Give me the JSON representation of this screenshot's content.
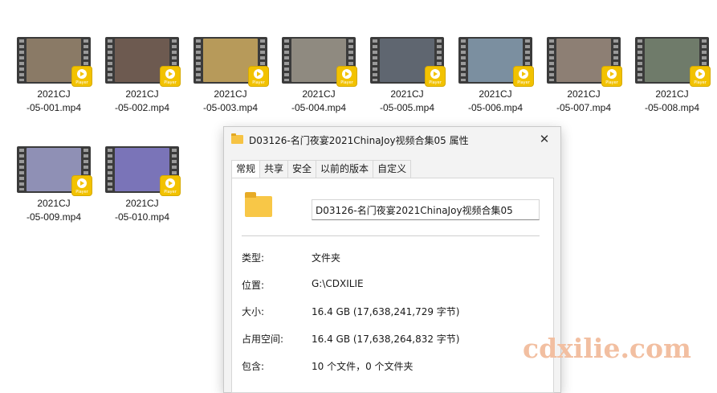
{
  "files": [
    {
      "line1": "2021CJ",
      "line2": "-05-001.mp4"
    },
    {
      "line1": "2021CJ",
      "line2": "-05-002.mp4"
    },
    {
      "line1": "2021CJ",
      "line2": "-05-003.mp4"
    },
    {
      "line1": "2021CJ",
      "line2": "-05-004.mp4"
    },
    {
      "line1": "2021CJ",
      "line2": "-05-005.mp4"
    },
    {
      "line1": "2021CJ",
      "line2": "-05-006.mp4"
    },
    {
      "line1": "2021CJ",
      "line2": "-05-007.mp4"
    },
    {
      "line1": "2021CJ",
      "line2": "-05-008.mp4"
    },
    {
      "line1": "2021CJ",
      "line2": "-05-009.mp4"
    },
    {
      "line1": "2021CJ",
      "line2": "-05-010.mp4"
    }
  ],
  "badge_label": "Player",
  "dialog": {
    "title": "D03126-名门夜宴2021ChinaJoy视频合集05 属性",
    "close_glyph": "✕",
    "tabs": [
      "常规",
      "共享",
      "安全",
      "以前的版本",
      "自定义"
    ],
    "name_value": "D03126-名门夜宴2021ChinaJoy视频合集05",
    "properties": [
      {
        "label": "类型:",
        "value": "文件夹"
      },
      {
        "label": "位置:",
        "value": "G:\\CDXILIE"
      },
      {
        "label": "大小:",
        "value": "16.4 GB (17,638,241,729 字节)"
      },
      {
        "label": "占用空间:",
        "value": "16.4 GB (17,638,264,832 字节)"
      },
      {
        "label": "包含:",
        "value": "10 个文件，0 个文件夹"
      }
    ]
  },
  "watermark": "cdxilie.com",
  "colors": {
    "folder": "#f6c343",
    "badge": "#f2c200",
    "watermark": "#f2bfa1"
  }
}
